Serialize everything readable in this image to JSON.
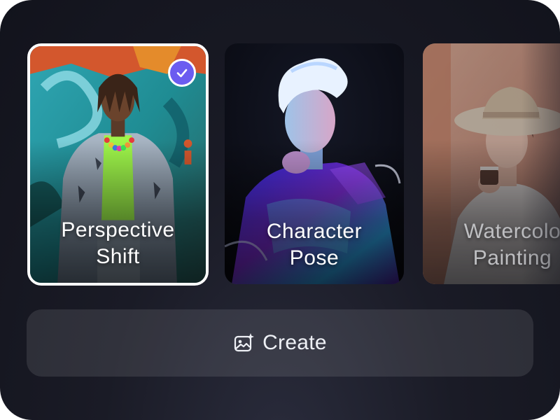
{
  "cards": [
    {
      "label_line1": "Perspective",
      "label_line2": "Shift",
      "selected": true,
      "image": "man-dreadlocks-denim-jacket-graffiti-wall"
    },
    {
      "label_line1": "Character",
      "label_line2": "Pose",
      "selected": false,
      "image": "man-white-hair-iridescent-jacket-neon"
    },
    {
      "label_line1": "Watercolo",
      "label_line2": "Painting",
      "selected": false,
      "image": "woman-sunhat-drinking-coffee"
    }
  ],
  "selected_badge_icon": "check-icon",
  "accent_color": "#6b5cf0",
  "create_button": {
    "label": "Create",
    "icon": "image-sparkle-icon"
  }
}
